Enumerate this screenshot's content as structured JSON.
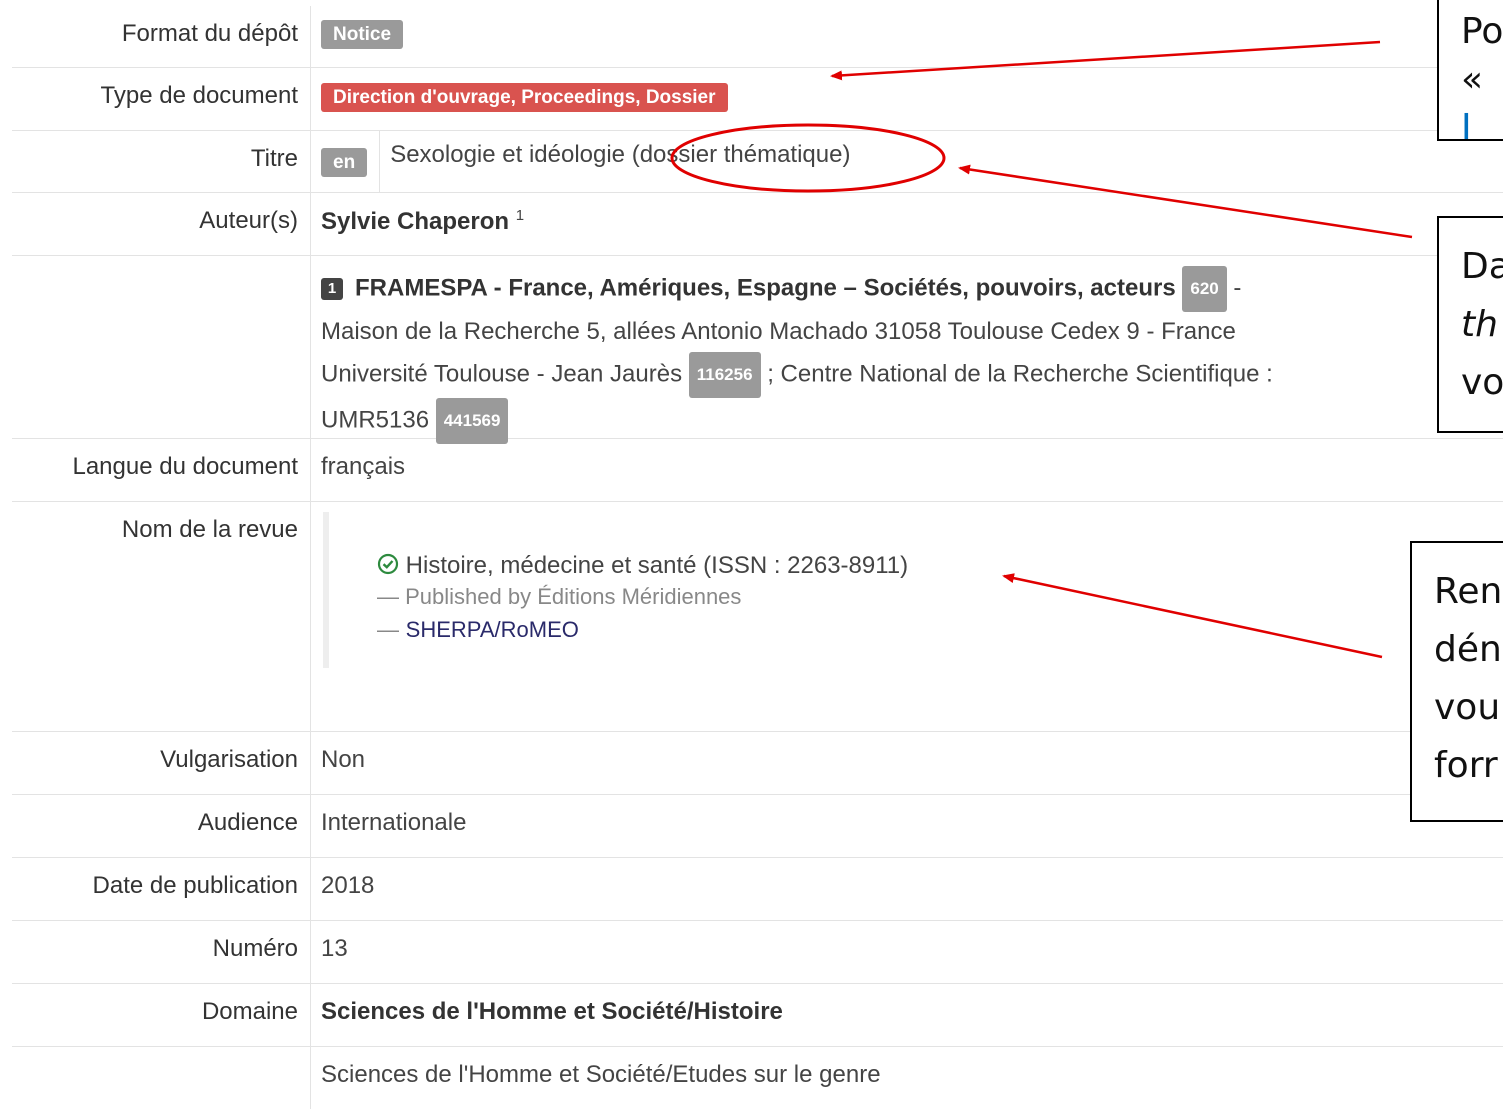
{
  "rows": {
    "format": {
      "label": "Format du dépôt",
      "badge": "Notice"
    },
    "type": {
      "label": "Type de document",
      "badge": "Direction d'ouvrage, Proceedings, Dossier"
    },
    "titre": {
      "label": "Titre",
      "lang": "en",
      "text": "Sexologie et idéologie (dossier thématique)"
    },
    "auteurs": {
      "label": "Auteur(s)",
      "author": "Sylvie Chaperon",
      "sup": "1",
      "affil_num": "1",
      "affil_name": "FRAMESPA - France, Amériques, Espagne – Sociétés, pouvoirs, acteurs",
      "affil_id": "620",
      "affil_dash": "-",
      "address": "Maison de la Recherche 5, allées Antonio Machado 31058 Toulouse Cedex 9 -  France",
      "univ": "Université Toulouse - Jean Jaurès",
      "univ_id": "116256",
      "cnrs": "; Centre National de la Recherche Scientifique :",
      "umr": "UMR5136",
      "umr_id": "441569"
    },
    "langue": {
      "label": "Langue du document",
      "value": "français"
    },
    "revue": {
      "label": "Nom de la revue",
      "journal": "Histoire, médecine et santé (ISSN : 2263-8911)",
      "publisher": "— Published by Éditions Méridiennes",
      "dash": "—",
      "sherpa": "SHERPA/RoMEO"
    },
    "vulgarisation": {
      "label": "Vulgarisation",
      "value": "Non"
    },
    "audience": {
      "label": "Audience",
      "value": "Internationale"
    },
    "date": {
      "label": "Date de publication",
      "value": "2018"
    },
    "numero": {
      "label": "Numéro",
      "value": "13"
    },
    "domaine": {
      "label": "Domaine",
      "value1": "Sciences de l'Homme et Société/Histoire",
      "value2": "Sciences de l'Homme et Société/Etudes sur le genre"
    }
  },
  "callouts": {
    "c1_line1": "Po",
    "c1_line2_prefix": "« ",
    "c1_line2_blue": "I",
    "c2_line1": "Da",
    "c2_line2": "th",
    "c2_line3": "vo",
    "c3_line1": "Ren",
    "c3_line2": "dén",
    "c3_line3": "vou",
    "c3_line4": "forr"
  },
  "colors": {
    "badge_red": "#d9534f",
    "badge_grey": "#9a9a9a",
    "annotation_red": "#e00000"
  }
}
